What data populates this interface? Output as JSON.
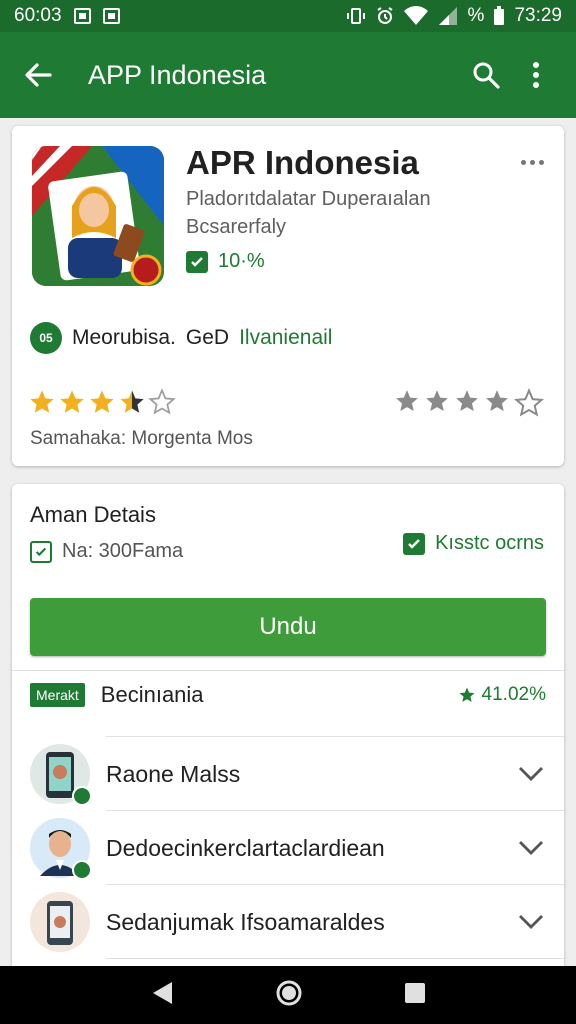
{
  "status": {
    "left_text": "60:03",
    "time": "73:29",
    "battery_text": "%"
  },
  "appbar": {
    "title": "APP Indonesia"
  },
  "app": {
    "name": "APR Indonesia",
    "dev_line1": "Pladorıtdalatar Duperaıalan",
    "dev_line2": "Bcsarerfaly",
    "percent": "10·%"
  },
  "meta": {
    "badge": "05",
    "text": "Meorubisa.",
    "code": "GeD",
    "highlight": "Ilvanienail"
  },
  "rating": {
    "stars_left": 3.5,
    "stars_right": 4,
    "caption": "Samahaka: Morgenta Mos"
  },
  "details": {
    "title": "Aman Detais",
    "sub": "Na: 300Fama",
    "tag": "Kısstc ocrns",
    "download_label": "Undu"
  },
  "section": {
    "tag": "Merakt",
    "title": "Becinıania",
    "right_value": "41.02%"
  },
  "list": [
    {
      "label": "Raone Malss"
    },
    {
      "label": "Dedoecinkerclartaclardiean"
    },
    {
      "label": "Sedanjumak Ifsoamaraldes"
    }
  ],
  "colors": {
    "primary": "#1f7a33",
    "status_bar": "#1b6b2c",
    "button": "#3f9c3a",
    "star": "#f2b01e"
  }
}
